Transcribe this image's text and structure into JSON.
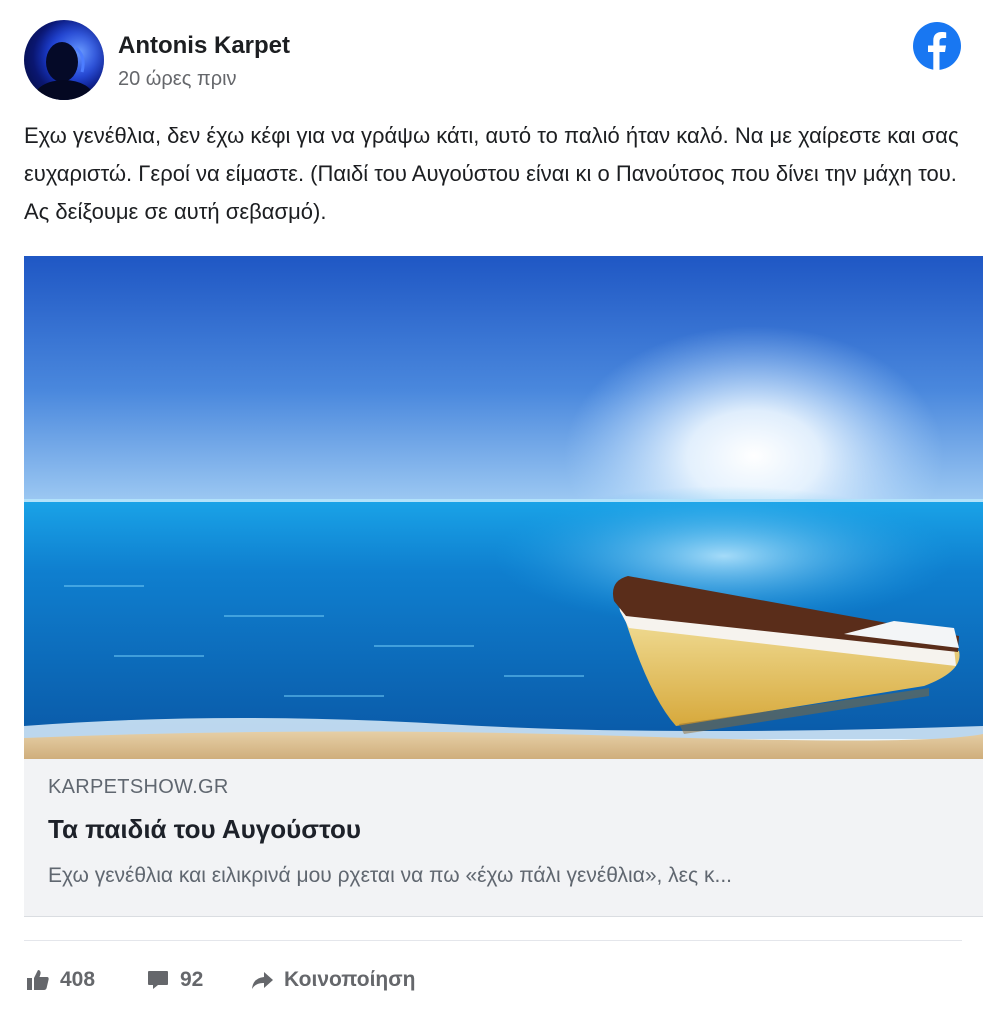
{
  "post": {
    "author": "Antonis Karpet",
    "timestamp": "20 ώρες πριν",
    "platform_icon": "facebook-icon",
    "text": "Εχω γενέθλια, δεν έχω κέφι για να γράψω κάτι, αυτό το παλιό ήταν καλό. Να με χαίρεστε και σας ευχαριστώ. Γεροί να είμαστε. (Παιδί του Αυγούστου είναι κι ο Πανούτσος που δίνει την μάχη του. Ας δείξουμε σε αυτή σεβασμό)."
  },
  "link_preview": {
    "image": "beach-boat-sea-image",
    "domain": "KARPETSHOW.GR",
    "title": "Τα παιδιά του Αυγούστου",
    "description": "Εχω γενέθλια και ειλικρινά μου ρχεται να πω «έχω πάλι γενέθλια», λες κ..."
  },
  "footer": {
    "likes_icon": "thumbs-up-icon",
    "likes": "408",
    "comments_icon": "comment-icon",
    "comments": "92",
    "share_icon": "share-arrow-icon",
    "share_label": "Κοινοποίηση"
  },
  "colors": {
    "facebook_blue": "#1877f2",
    "secondary_text": "#65676b",
    "preview_background": "#f2f3f5"
  }
}
